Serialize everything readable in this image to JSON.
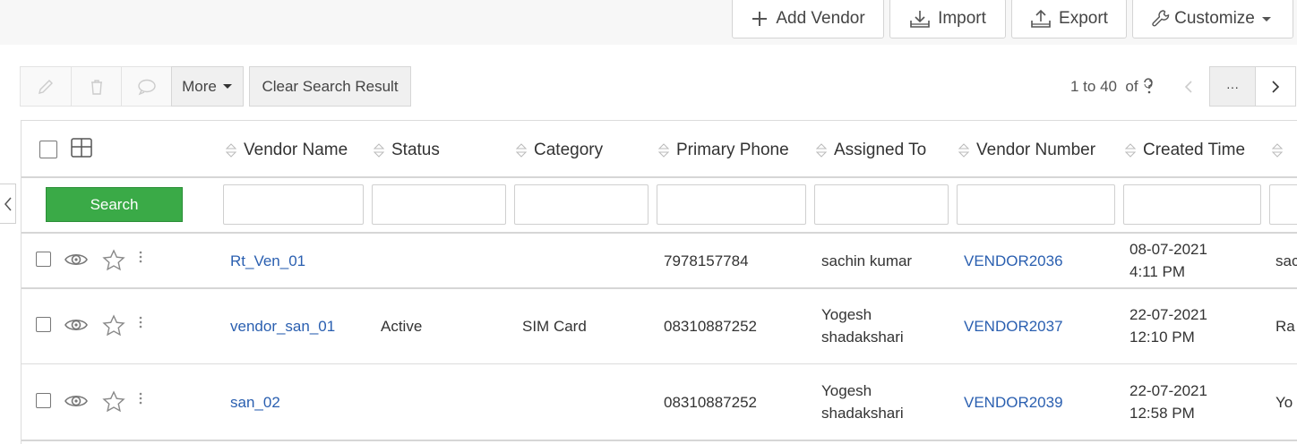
{
  "header": {
    "add_vendor": "Add Vendor",
    "import": "Import",
    "export": "Export",
    "customize": "Customize"
  },
  "toolbar": {
    "more": "More",
    "clear_search": "Clear Search Result",
    "pagination": "1 to 40  of",
    "pagination_more": "···"
  },
  "table": {
    "columns": [
      "Vendor Name",
      "Status",
      "Category",
      "Primary Phone",
      "Assigned To",
      "Vendor Number",
      "Created Time"
    ],
    "search_label": "Search",
    "rows": [
      {
        "vendor_name": "Rt_Ven_01",
        "status": "",
        "category": "",
        "phone": "7978157784",
        "assigned_1": "sachin kumar",
        "assigned_2": "",
        "vendor_number": "VENDOR2036",
        "created_1": "08-07-2021",
        "created_2": "4:11 PM",
        "extra": "sac"
      },
      {
        "vendor_name": "vendor_san_01",
        "status": "Active",
        "category": "SIM Card",
        "phone": "08310887252",
        "assigned_1": "Yogesh",
        "assigned_2": "shadakshari",
        "vendor_number": "VENDOR2037",
        "created_1": "22-07-2021",
        "created_2": "12:10 PM",
        "extra": "Ra"
      },
      {
        "vendor_name": "san_02",
        "status": "",
        "category": "",
        "phone": "08310887252",
        "assigned_1": "Yogesh",
        "assigned_2": "shadakshari",
        "vendor_number": "VENDOR2039",
        "created_1": "22-07-2021",
        "created_2": "12:58 PM",
        "extra": "Yo"
      }
    ]
  },
  "colors": {
    "link": "#2a5fb0",
    "search_button": "#3aaa47"
  }
}
